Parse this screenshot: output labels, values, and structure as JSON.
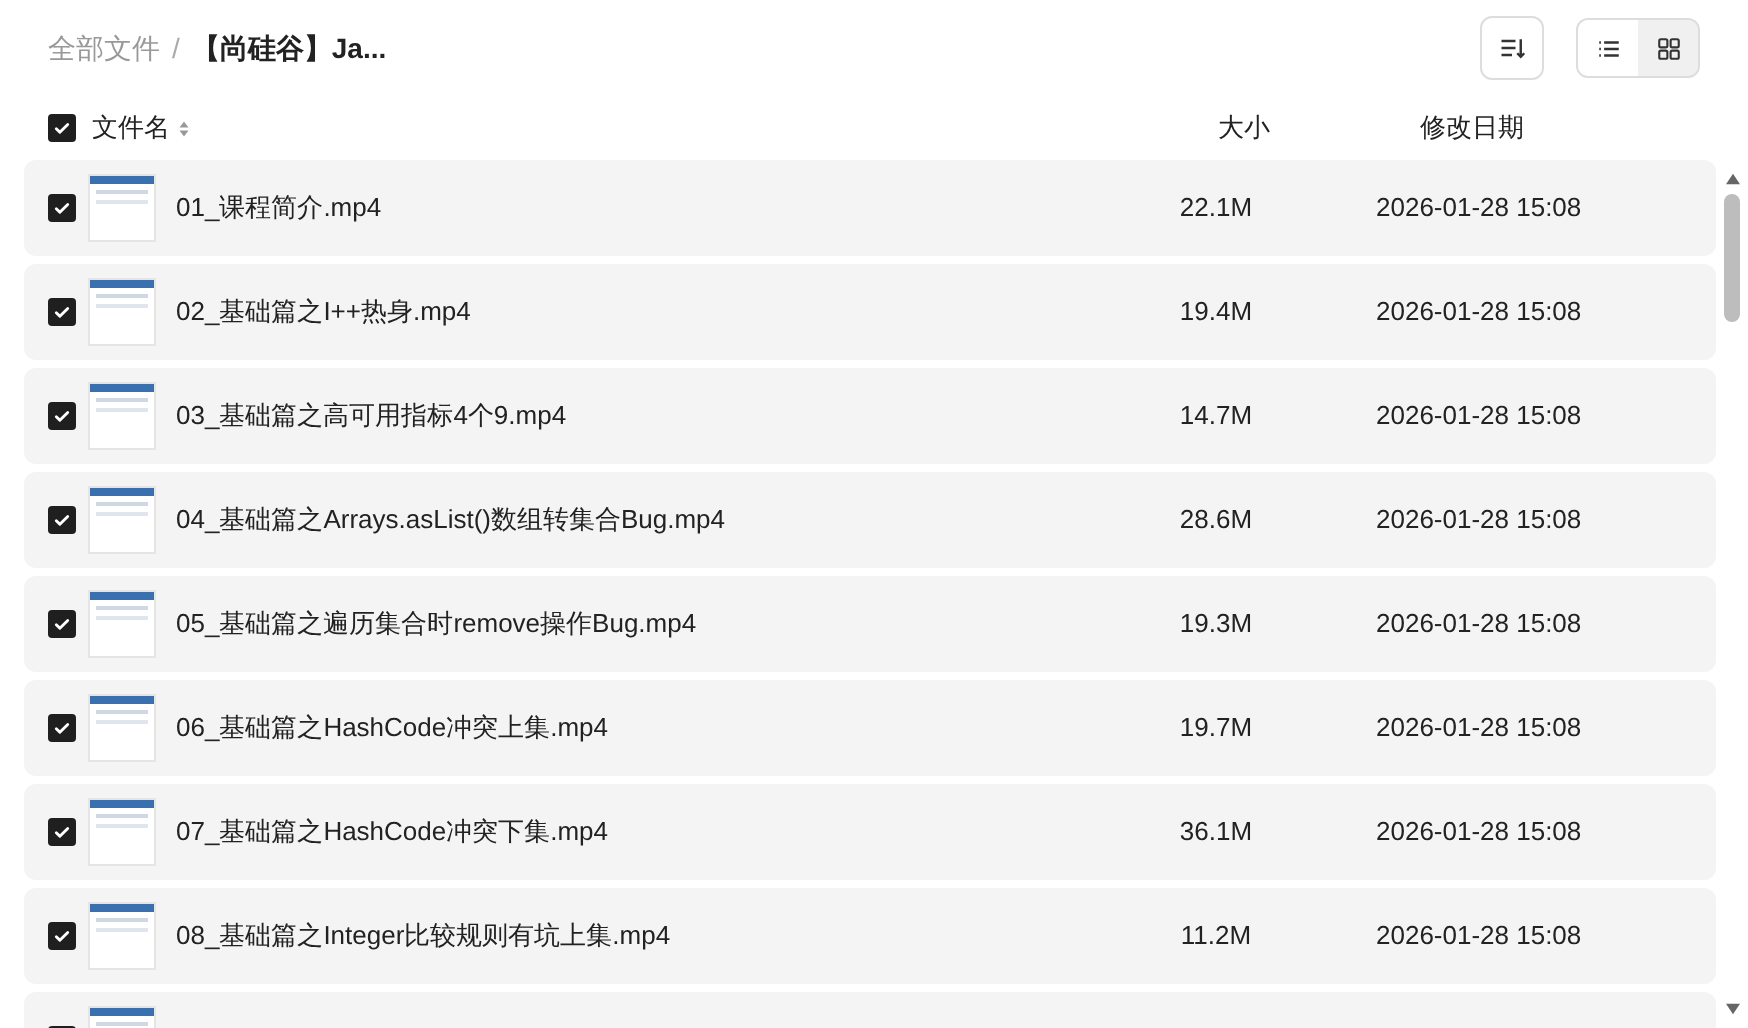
{
  "breadcrumb": [
    {
      "label": "全部文件"
    },
    {
      "label": "【尚硅谷】Ja..."
    }
  ],
  "breadcrumb_separator": "/",
  "view_modes": [
    {
      "kind": "list",
      "selected": true
    },
    {
      "kind": "grid",
      "selected": false
    }
  ],
  "table": {
    "select_all_checked": true,
    "columns": [
      "文件名",
      "大小",
      "修改日期"
    ],
    "rows": [
      {
        "checked": true,
        "name": "01_课程简介.mp4",
        "size": "22.1M",
        "modified": "2026-01-28 15:08"
      },
      {
        "checked": true,
        "name": "02_基础篇之I++热身.mp4",
        "size": "19.4M",
        "modified": "2026-01-28 15:08"
      },
      {
        "checked": true,
        "name": "03_基础篇之高可用指标4个9.mp4",
        "size": "14.7M",
        "modified": "2026-01-28 15:08"
      },
      {
        "checked": true,
        "name": "04_基础篇之Arrays.asList()数组转集合Bug.mp4",
        "size": "28.6M",
        "modified": "2026-01-28 15:08"
      },
      {
        "checked": true,
        "name": "05_基础篇之遍历集合时remove操作Bug.mp4",
        "size": "19.3M",
        "modified": "2026-01-28 15:08"
      },
      {
        "checked": true,
        "name": "06_基础篇之HashCode冲突上集.mp4",
        "size": "19.7M",
        "modified": "2026-01-28 15:08"
      },
      {
        "checked": true,
        "name": "07_基础篇之HashCode冲突下集.mp4",
        "size": "36.1M",
        "modified": "2026-01-28 15:08"
      },
      {
        "checked": true,
        "name": "08_基础篇之Integer比较规则有坑上集.mp4",
        "size": "11.2M",
        "modified": "2026-01-28 15:08"
      },
      {
        "checked": true
      }
    ]
  }
}
